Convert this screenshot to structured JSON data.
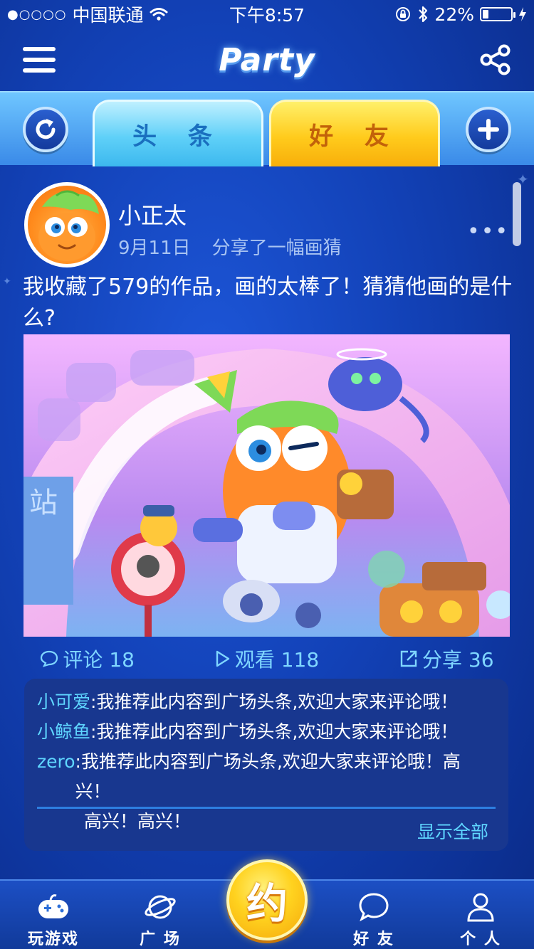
{
  "status_bar": {
    "carrier": "中国联通",
    "time": "下午8:57",
    "battery": "22%",
    "battery_level": 0.22
  },
  "header": {
    "title": "Party"
  },
  "tabs": [
    {
      "label": "头 条",
      "active": false
    },
    {
      "label": "好 友",
      "active": true
    }
  ],
  "post": {
    "username": "小正太",
    "date": "9月11日",
    "action": "分享了一幅画猜",
    "more": "•••",
    "text": "我收藏了579的作品，画的太棒了！猜猜他画的是什么?",
    "stats": {
      "comment_label": "评论 18",
      "view_label": "观看 118",
      "share_label": "分享 36"
    },
    "comments": [
      {
        "name": "小可爱",
        "text": ":我推荐此内容到广场头条,欢迎大家来评论哦！"
      },
      {
        "name": "小鲸鱼",
        "text": ":我推荐此内容到广场头条,欢迎大家来评论哦！"
      },
      {
        "name": "zero",
        "text": ":我推荐此内容到广场头条,欢迎大家来评论哦！高兴！",
        "continuation": "高兴！高兴！"
      }
    ],
    "show_all": "显示全部"
  },
  "bottom_nav": {
    "items": [
      {
        "label": "玩游戏",
        "icon": "gamepad-icon"
      },
      {
        "label": "广 场",
        "icon": "planet-icon"
      },
      {
        "label": "好 友",
        "icon": "chat-bubble-icon"
      },
      {
        "label": "个 人",
        "icon": "person-icon"
      }
    ],
    "center_label": "约"
  },
  "colors": {
    "accent_cyan": "#5fd6ff",
    "tab_yellow": "#ffcb1c",
    "tab_cyan": "#5fd0f8",
    "bg_blue": "#1241b6"
  }
}
